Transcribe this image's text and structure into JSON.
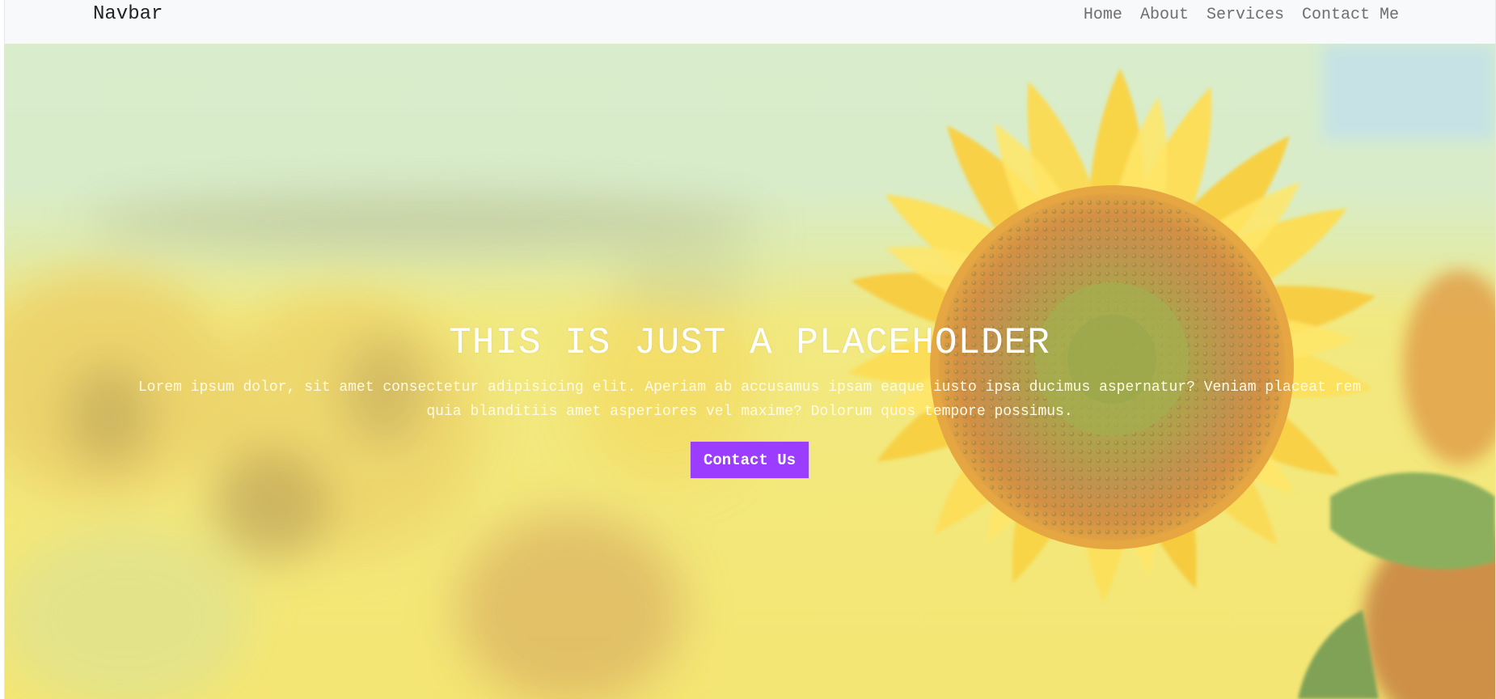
{
  "navbar": {
    "brand": "Navbar",
    "links": [
      "Home",
      "About",
      "Services",
      "Contact Me"
    ]
  },
  "hero": {
    "title": "THIS IS JUST A PLACEHOLDER",
    "text": "Lorem ipsum dolor, sit amet consectetur adipisicing elit. Aperiam ab accusamus ipsam eaque iusto ipsa ducimus aspernatur? Veniam placeat rem quia blanditiis amet asperiores vel maxime? Dolorum quos tempore possimus.",
    "button_label": "Contact Us",
    "background_image": "sunflower-field"
  },
  "colors": {
    "navbar_bg": "#f8f9fa",
    "button_bg": "#9b3dff",
    "accent_yellow": "#f7d22c"
  }
}
